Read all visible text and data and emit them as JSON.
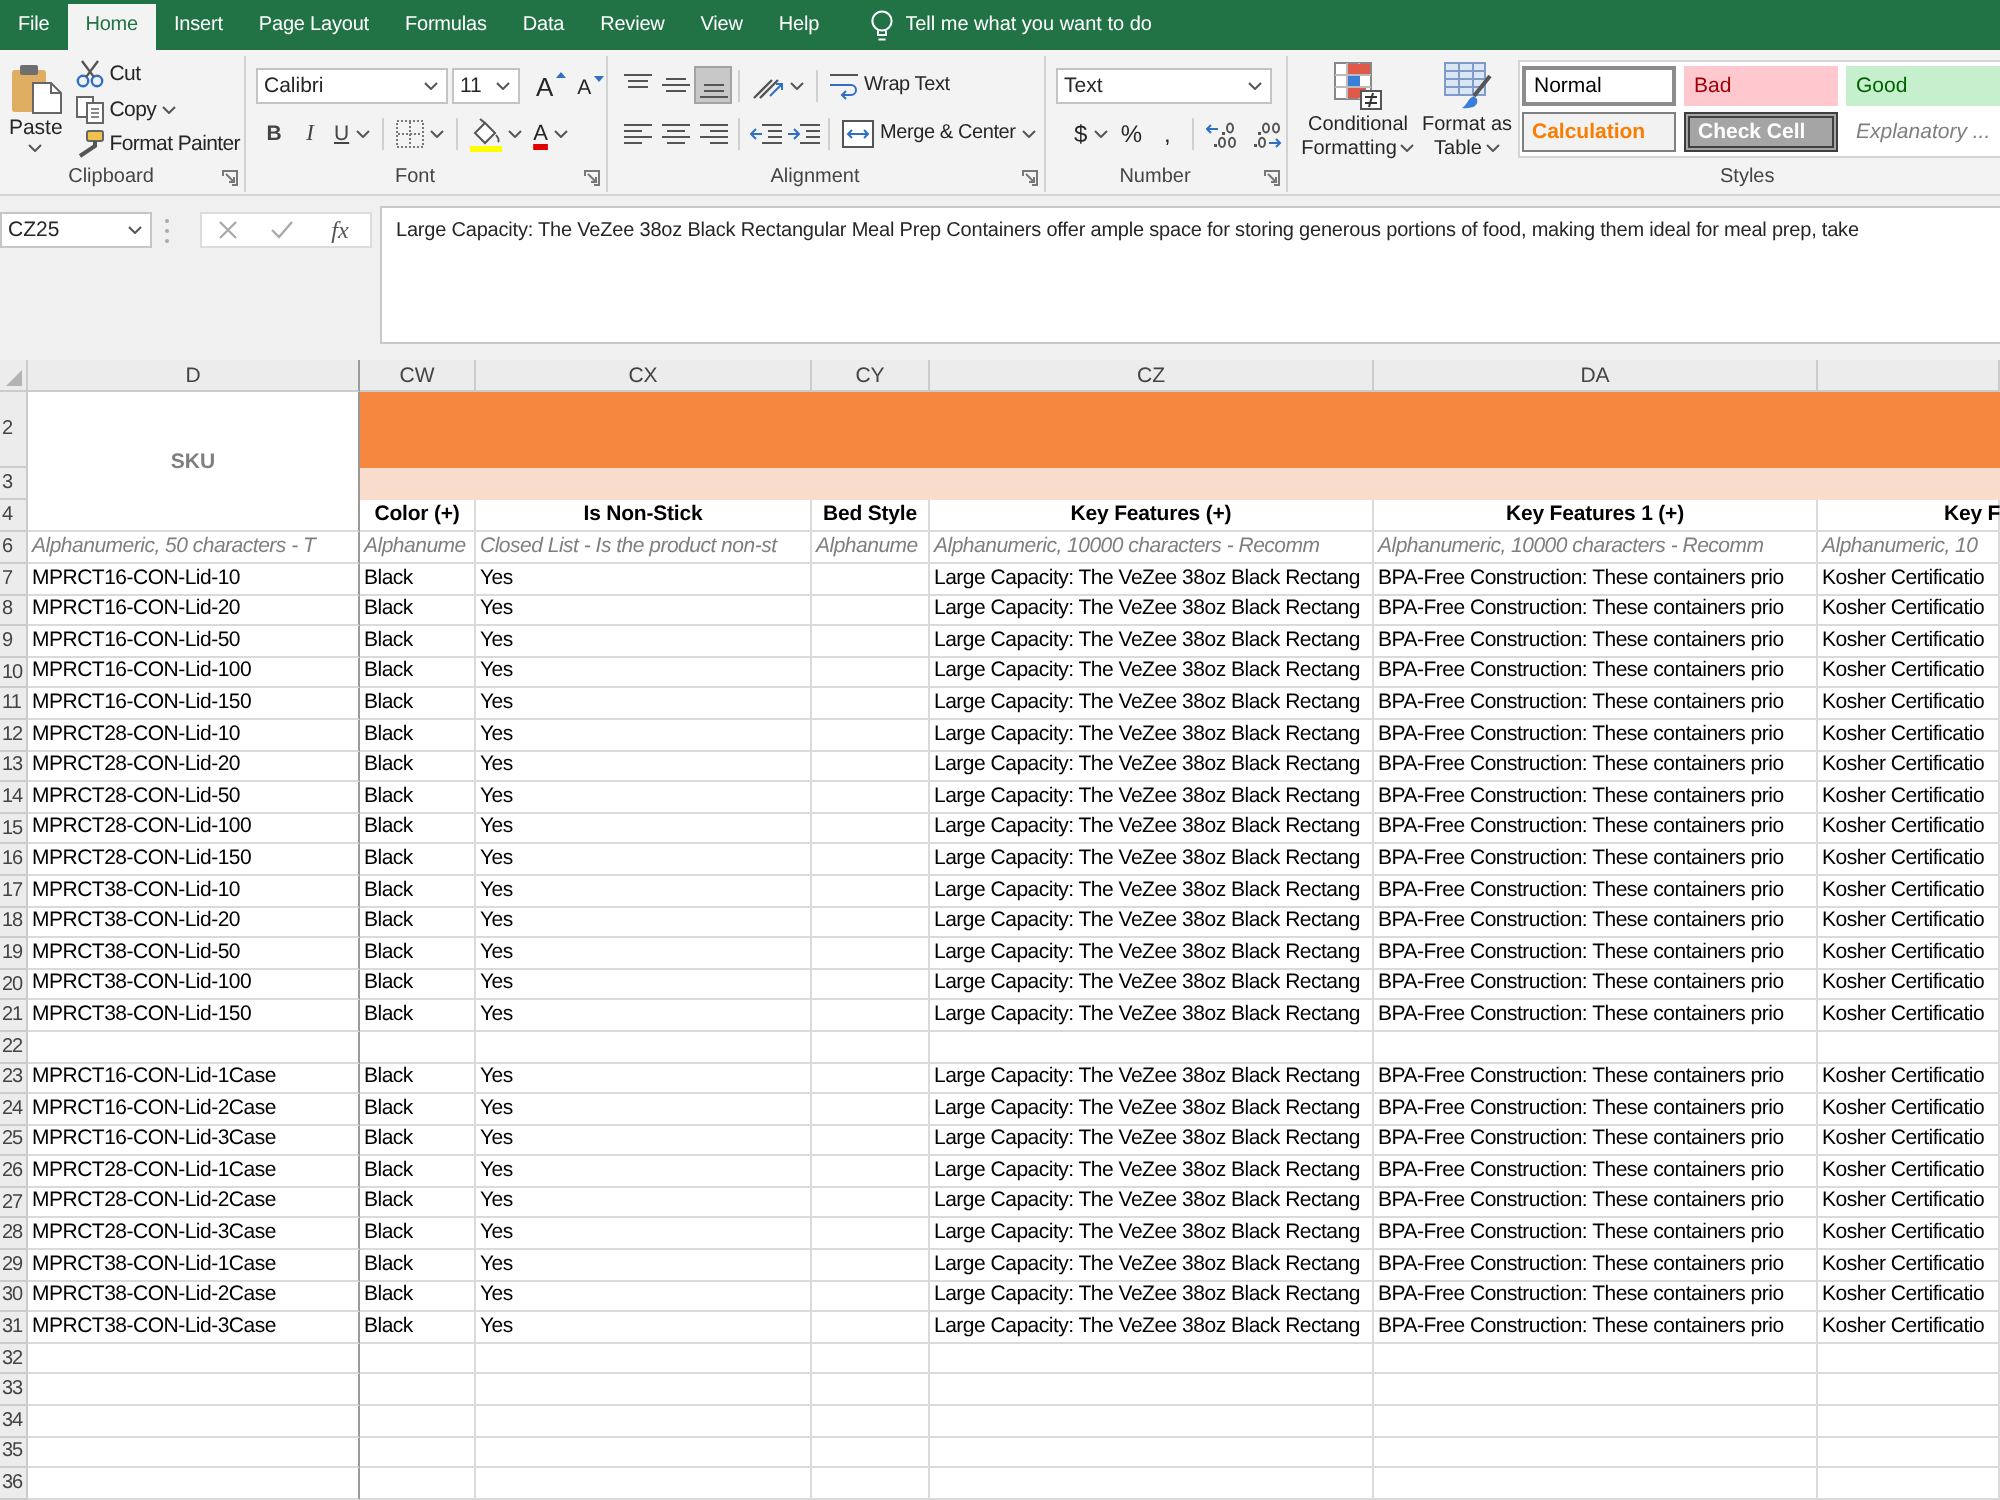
{
  "ribbon_tabs": [
    {
      "label": "File",
      "selected": false
    },
    {
      "label": "Home",
      "selected": true
    },
    {
      "label": "Insert",
      "selected": false
    },
    {
      "label": "Page Layout",
      "selected": false
    },
    {
      "label": "Formulas",
      "selected": false
    },
    {
      "label": "Data",
      "selected": false
    },
    {
      "label": "Review",
      "selected": false
    },
    {
      "label": "View",
      "selected": false
    },
    {
      "label": "Help",
      "selected": false
    }
  ],
  "tell_me": {
    "placeholder": "Tell me what you want to do"
  },
  "ribbon": {
    "clipboard": {
      "paste": "Paste",
      "cut": "Cut",
      "copy": "Copy",
      "format_painter": "Format Painter",
      "label": "Clipboard"
    },
    "font": {
      "font_name": "Calibri",
      "font_size": "11",
      "grow_font": "A",
      "shrink_font": "A",
      "bold": "B",
      "italic": "I",
      "underline": "U",
      "font_color": "A",
      "label": "Font"
    },
    "alignment": {
      "vertical": [
        {
          "kind": "top",
          "selected": false
        },
        {
          "kind": "middle",
          "selected": false
        },
        {
          "kind": "bottom",
          "selected": true
        }
      ],
      "horizontal": [
        {
          "kind": "left",
          "selected": false
        },
        {
          "kind": "center",
          "selected": false
        },
        {
          "kind": "right",
          "selected": false
        }
      ],
      "wrap_text": "Wrap Text",
      "merge_center": "Merge & Center",
      "label": "Alignment"
    },
    "number": {
      "format": "Text",
      "currency": "$",
      "percent": "%",
      "comma": ",",
      "label": "Number"
    },
    "styles": {
      "conditional_formatting": "Conditional Formatting",
      "format_as_table": "Format as Table",
      "cell_styles": [
        {
          "label": "Normal",
          "kind": "normal"
        },
        {
          "label": "Bad",
          "kind": "bad"
        },
        {
          "label": "Good",
          "kind": "good"
        },
        {
          "label": "Calculation",
          "kind": "calculation"
        },
        {
          "label": "Check Cell",
          "kind": "check"
        },
        {
          "label": "Explanatory ...",
          "kind": "explanatory"
        }
      ],
      "label": "Styles"
    }
  },
  "formula_bar": {
    "name_box": "CZ25",
    "function_button": "fx",
    "content": "Large Capacity: The VeZee 38oz Black Rectangular Meal Prep Containers offer ample space for storing generous portions of food, making them ideal for meal prep, take"
  },
  "sheet": {
    "columns": [
      "D",
      "CW",
      "CX",
      "CY",
      "CZ",
      "DA"
    ],
    "merged_heading": "SKU",
    "rows": [
      {
        "number": "2",
        "kind": "band",
        "color": "#f5873f"
      },
      {
        "number": "3",
        "kind": "band",
        "color": "#f9dccb"
      },
      {
        "number": "4",
        "kind": "heading",
        "cells": [
          "Color (+)",
          "Is Non-Stick",
          "Bed Style",
          "Key Features (+)",
          "Key Features 1 (+)",
          "Key F"
        ]
      },
      {
        "number": "6",
        "kind": "hint",
        "cells": [
          "Alphanumeric, 50 characters - T",
          "Alphanume",
          "Closed List - Is the product non-st",
          "Alphanume",
          "Alphanumeric, 10000 characters - Recomm",
          "Alphanumeric, 10000 characters - Recomm",
          "Alphanumeric, 10"
        ]
      },
      {
        "number": "7",
        "kind": "data",
        "cells": [
          "MPRCT16-CON-Lid-10",
          "Black",
          "Yes",
          null,
          "Large Capacity: The VeZee 38oz Black Rectang",
          "BPA-Free Construction: These containers prio",
          "Kosher Certificatio"
        ]
      },
      {
        "number": "8",
        "kind": "data",
        "cells": [
          "MPRCT16-CON-Lid-20",
          "Black",
          "Yes",
          null,
          "Large Capacity: The VeZee 38oz Black Rectang",
          "BPA-Free Construction: These containers prio",
          "Kosher Certificatio"
        ]
      },
      {
        "number": "9",
        "kind": "data",
        "cells": [
          "MPRCT16-CON-Lid-50",
          "Black",
          "Yes",
          null,
          "Large Capacity: The VeZee 38oz Black Rectang",
          "BPA-Free Construction: These containers prio",
          "Kosher Certificatio"
        ]
      },
      {
        "number": "10",
        "kind": "data",
        "cells": [
          "MPRCT16-CON-Lid-100",
          "Black",
          "Yes",
          null,
          "Large Capacity: The VeZee 38oz Black Rectang",
          "BPA-Free Construction: These containers prio",
          "Kosher Certificatio"
        ]
      },
      {
        "number": "11",
        "kind": "data",
        "cells": [
          "MPRCT16-CON-Lid-150",
          "Black",
          "Yes",
          null,
          "Large Capacity: The VeZee 38oz Black Rectang",
          "BPA-Free Construction: These containers prio",
          "Kosher Certificatio"
        ]
      },
      {
        "number": "12",
        "kind": "data",
        "cells": [
          "MPRCT28-CON-Lid-10",
          "Black",
          "Yes",
          null,
          "Large Capacity: The VeZee 38oz Black Rectang",
          "BPA-Free Construction: These containers prio",
          "Kosher Certificatio"
        ]
      },
      {
        "number": "13",
        "kind": "data",
        "cells": [
          "MPRCT28-CON-Lid-20",
          "Black",
          "Yes",
          null,
          "Large Capacity: The VeZee 38oz Black Rectang",
          "BPA-Free Construction: These containers prio",
          "Kosher Certificatio"
        ]
      },
      {
        "number": "14",
        "kind": "data",
        "cells": [
          "MPRCT28-CON-Lid-50",
          "Black",
          "Yes",
          null,
          "Large Capacity: The VeZee 38oz Black Rectang",
          "BPA-Free Construction: These containers prio",
          "Kosher Certificatio"
        ]
      },
      {
        "number": "15",
        "kind": "data",
        "cells": [
          "MPRCT28-CON-Lid-100",
          "Black",
          "Yes",
          null,
          "Large Capacity: The VeZee 38oz Black Rectang",
          "BPA-Free Construction: These containers prio",
          "Kosher Certificatio"
        ]
      },
      {
        "number": "16",
        "kind": "data",
        "cells": [
          "MPRCT28-CON-Lid-150",
          "Black",
          "Yes",
          null,
          "Large Capacity: The VeZee 38oz Black Rectang",
          "BPA-Free Construction: These containers prio",
          "Kosher Certificatio"
        ]
      },
      {
        "number": "17",
        "kind": "data",
        "cells": [
          "MPRCT38-CON-Lid-10",
          "Black",
          "Yes",
          null,
          "Large Capacity: The VeZee 38oz Black Rectang",
          "BPA-Free Construction: These containers prio",
          "Kosher Certificatio"
        ]
      },
      {
        "number": "18",
        "kind": "data",
        "cells": [
          "MPRCT38-CON-Lid-20",
          "Black",
          "Yes",
          null,
          "Large Capacity: The VeZee 38oz Black Rectang",
          "BPA-Free Construction: These containers prio",
          "Kosher Certificatio"
        ]
      },
      {
        "number": "19",
        "kind": "data",
        "cells": [
          "MPRCT38-CON-Lid-50",
          "Black",
          "Yes",
          null,
          "Large Capacity: The VeZee 38oz Black Rectang",
          "BPA-Free Construction: These containers prio",
          "Kosher Certificatio"
        ]
      },
      {
        "number": "20",
        "kind": "data",
        "cells": [
          "MPRCT38-CON-Lid-100",
          "Black",
          "Yes",
          null,
          "Large Capacity: The VeZee 38oz Black Rectang",
          "BPA-Free Construction: These containers prio",
          "Kosher Certificatio"
        ]
      },
      {
        "number": "21",
        "kind": "data",
        "cells": [
          "MPRCT38-CON-Lid-150",
          "Black",
          "Yes",
          null,
          "Large Capacity: The VeZee 38oz Black Rectang",
          "BPA-Free Construction: These containers prio",
          "Kosher Certificatio"
        ]
      },
      {
        "number": "22",
        "kind": "data"
      },
      {
        "number": "23",
        "kind": "data",
        "cells": [
          "MPRCT16-CON-Lid-1Case",
          "Black",
          "Yes",
          null,
          "Large Capacity: The VeZee 38oz Black Rectang",
          "BPA-Free Construction: These containers prio",
          "Kosher Certificatio"
        ]
      },
      {
        "number": "24",
        "kind": "data",
        "cells": [
          "MPRCT16-CON-Lid-2Case",
          "Black",
          "Yes",
          null,
          "Large Capacity: The VeZee 38oz Black Rectang",
          "BPA-Free Construction: These containers prio",
          "Kosher Certificatio"
        ]
      },
      {
        "number": "25",
        "kind": "data",
        "cells": [
          "MPRCT16-CON-Lid-3Case",
          "Black",
          "Yes",
          null,
          "Large Capacity: The VeZee 38oz Black Rectang",
          "BPA-Free Construction: These containers prio",
          "Kosher Certificatio"
        ]
      },
      {
        "number": "26",
        "kind": "data",
        "cells": [
          "MPRCT28-CON-Lid-1Case",
          "Black",
          "Yes",
          null,
          "Large Capacity: The VeZee 38oz Black Rectang",
          "BPA-Free Construction: These containers prio",
          "Kosher Certificatio"
        ]
      },
      {
        "number": "27",
        "kind": "data",
        "cells": [
          "MPRCT28-CON-Lid-2Case",
          "Black",
          "Yes",
          null,
          "Large Capacity: The VeZee 38oz Black Rectang",
          "BPA-Free Construction: These containers prio",
          "Kosher Certificatio"
        ]
      },
      {
        "number": "28",
        "kind": "data",
        "cells": [
          "MPRCT28-CON-Lid-3Case",
          "Black",
          "Yes",
          null,
          "Large Capacity: The VeZee 38oz Black Rectang",
          "BPA-Free Construction: These containers prio",
          "Kosher Certificatio"
        ]
      },
      {
        "number": "29",
        "kind": "data",
        "cells": [
          "MPRCT38-CON-Lid-1Case",
          "Black",
          "Yes",
          null,
          "Large Capacity: The VeZee 38oz Black Rectang",
          "BPA-Free Construction: These containers prio",
          "Kosher Certificatio"
        ]
      },
      {
        "number": "30",
        "kind": "data",
        "cells": [
          "MPRCT38-CON-Lid-2Case",
          "Black",
          "Yes",
          null,
          "Large Capacity: The VeZee 38oz Black Rectang",
          "BPA-Free Construction: These containers prio",
          "Kosher Certificatio"
        ]
      },
      {
        "number": "31",
        "kind": "data",
        "cells": [
          "MPRCT38-CON-Lid-3Case",
          "Black",
          "Yes",
          null,
          "Large Capacity: The VeZee 38oz Black Rectang",
          "BPA-Free Construction: These containers prio",
          "Kosher Certificatio"
        ]
      },
      {
        "number": "32",
        "kind": "data"
      },
      {
        "number": "33",
        "kind": "data"
      },
      {
        "number": "34",
        "kind": "data"
      },
      {
        "number": "35",
        "kind": "data"
      },
      {
        "number": "36",
        "kind": "data"
      }
    ]
  }
}
